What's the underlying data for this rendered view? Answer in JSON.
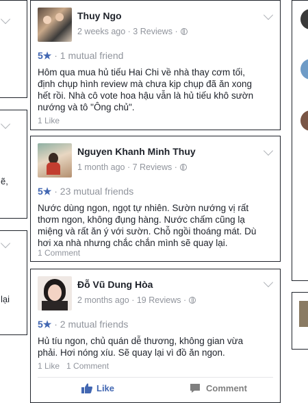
{
  "left_column": {
    "fragment_1": "ẽ,",
    "fragment_2": "lại"
  },
  "reviews": [
    {
      "name": "Thuy Ngo",
      "time": "2 weeks ago",
      "reviews": "3 Reviews",
      "rating": "5★",
      "mutual": "1 mutual friend",
      "text": "Hôm qua mua hủ tiếu Hai Chi về nhà thay cơm tối, định chụp hình review mà chưa kịp chụp đã ăn xong hết rồi. Nhà cô vote hoa hậu vẫn là hủ tiếu khô sườn nướng và tô \"Ông chủ\".",
      "footer": "1 Like"
    },
    {
      "name": "Nguyen Khanh Minh Thuy",
      "time": "1 month ago",
      "reviews": "7 Reviews",
      "rating": "5★",
      "mutual": "23 mutual friends",
      "text": "Nước dùng ngon, ngọt tự nhiên. Sườn nướng vị rất thơm ngon, không đụng hàng. Nước chấm cũng lạ miệng và rất ăn ý với sườn. Chỗ ngồi thoáng mát. Dù hơi xa nhà nhưng chắc chắn mình sẽ quay lại.",
      "footer": "1 Comment"
    },
    {
      "name": "Đỗ Vũ Dung Hòa",
      "time": "2 months ago",
      "reviews": "19 Reviews",
      "rating": "5★",
      "mutual": "2 mutual friends",
      "text": "Hủ tíu ngon, chủ quán dễ thương, không gian vừa phải. Hơi nóng xíu. Sẽ quay lại vì đồ ăn ngon.",
      "footer_like": "1 Like",
      "footer_comment": "1 Comment",
      "like_label": "Like",
      "comment_label": "Comment"
    }
  ],
  "colors": {
    "accent": "#4267b2",
    "muted": "#90949c",
    "text": "#1d2129"
  }
}
